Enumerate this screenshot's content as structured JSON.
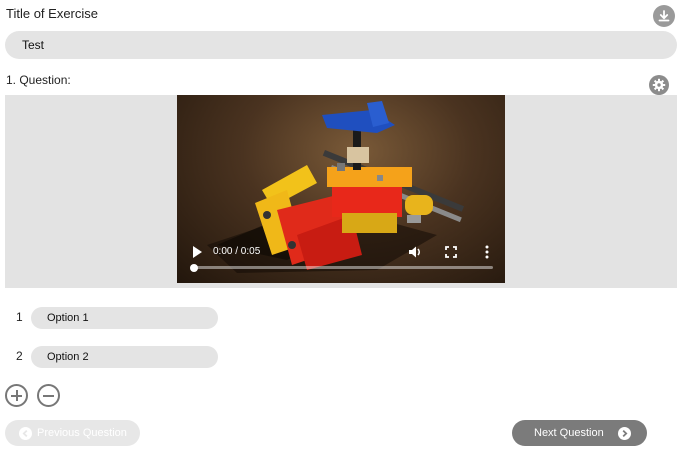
{
  "exercise": {
    "title_label": "Title of Exercise",
    "title_value": "Test"
  },
  "question": {
    "label": "1. Question:"
  },
  "video": {
    "time_display": "0:00 / 0:05",
    "progress": 0
  },
  "options": [
    {
      "number": "1",
      "value": "Option 1"
    },
    {
      "number": "2",
      "value": "Option 2"
    }
  ],
  "navigation": {
    "previous_label": "Previous Question",
    "next_label": "Next Question"
  },
  "icons": {
    "download": "download-icon",
    "settings": "gear-icon",
    "add": "plus-circle-icon",
    "remove": "minus-circle-icon"
  },
  "colors": {
    "field_background": "#e4e4e4",
    "icon_gray": "#9a9a9a",
    "next_button": "#7b7b7b",
    "prev_button_disabled": "#e7e7e7"
  }
}
